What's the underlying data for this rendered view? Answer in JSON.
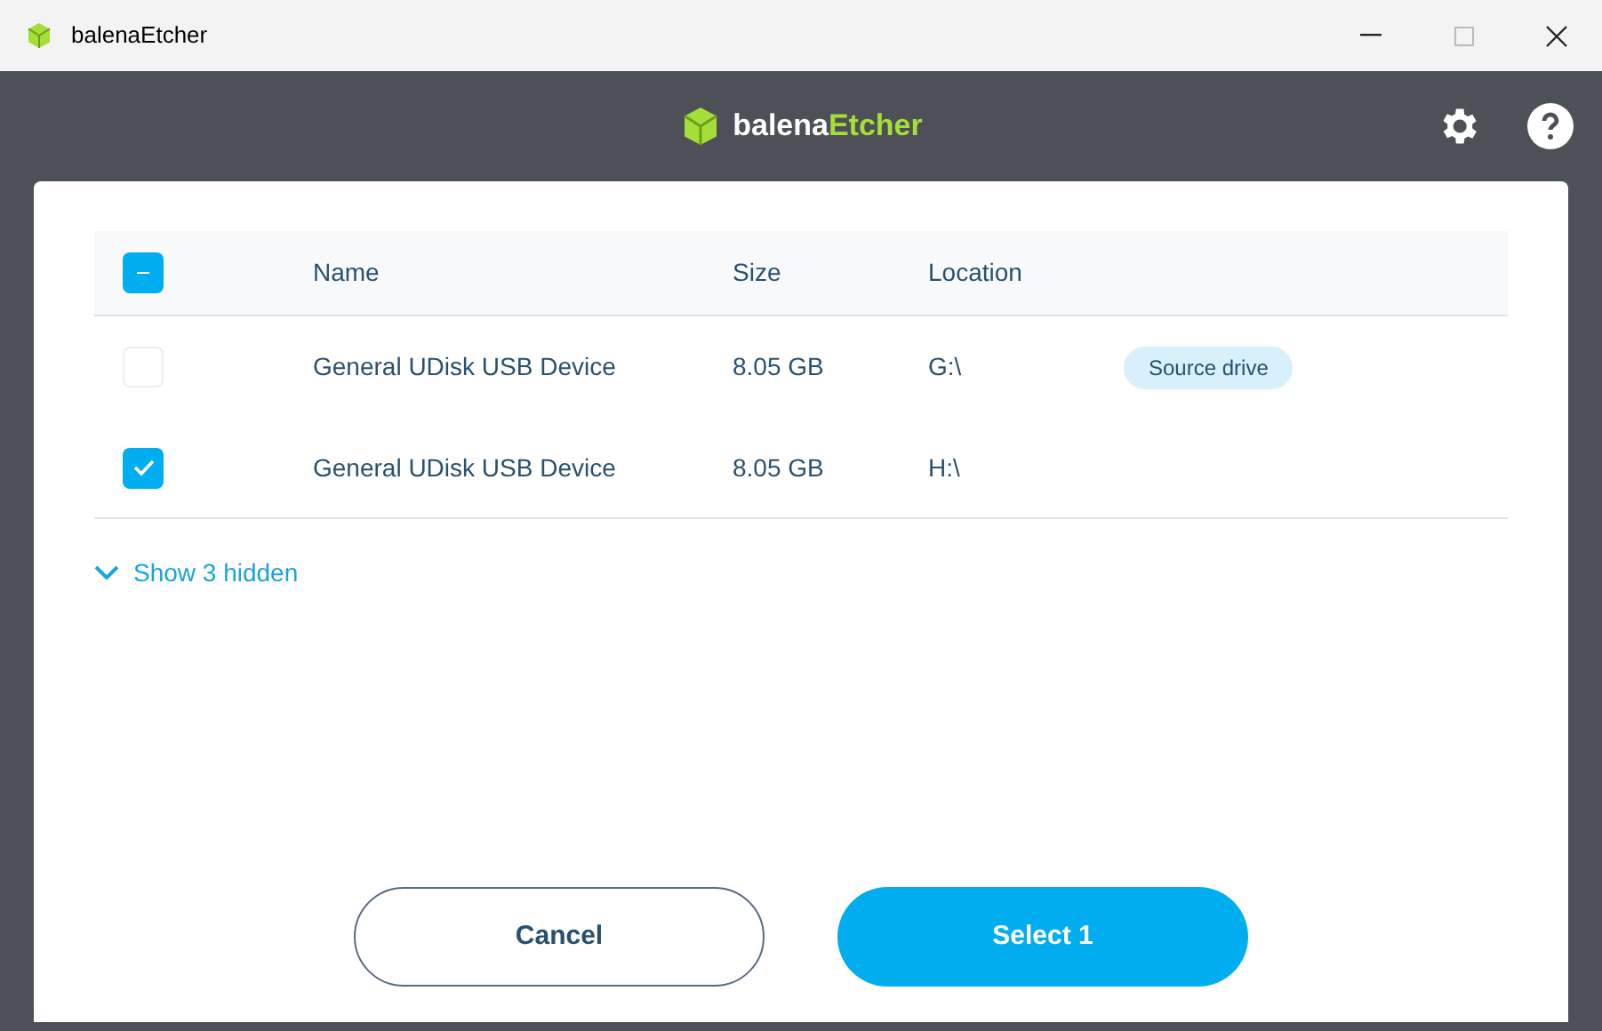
{
  "window": {
    "title": "balenaEtcher"
  },
  "header": {
    "logo_first": "balena",
    "logo_second": "Etcher"
  },
  "table": {
    "select_all": {
      "checked": true,
      "indeterminate": true
    },
    "columns": [
      "Name",
      "Size",
      "Location"
    ],
    "rows": [
      {
        "checked": false,
        "name": "General UDisk USB Device",
        "size": "8.05 GB",
        "location": "G:\\",
        "badge": "Source drive"
      },
      {
        "checked": true,
        "name": "General UDisk USB Device",
        "size": "8.05 GB",
        "location": "H:\\"
      }
    ]
  },
  "show_hidden": {
    "label": "Show 3 hidden",
    "expanded": false
  },
  "buttons": [
    {
      "kind": "secondary",
      "label": "Cancel"
    },
    {
      "kind": "primary",
      "label": "Select 1"
    }
  ]
}
